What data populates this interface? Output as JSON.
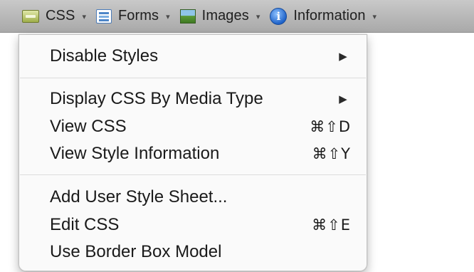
{
  "toolbar": {
    "items": [
      {
        "label": "CSS",
        "icon": "css-icon"
      },
      {
        "label": "Forms",
        "icon": "forms-icon"
      },
      {
        "label": "Images",
        "icon": "images-icon"
      },
      {
        "label": "Information",
        "icon": "info-icon",
        "icon_glyph": "i"
      }
    ],
    "caret": "▾"
  },
  "menu": {
    "items": [
      {
        "label": "Disable Styles",
        "arrow": "▶"
      },
      {
        "label": "Display CSS By Media Type",
        "arrow": "▶"
      },
      {
        "label": "View CSS",
        "shortcut": "⌘⇧D"
      },
      {
        "label": "View Style Information",
        "shortcut": "⌘⇧Y"
      },
      {
        "label": "Add User Style Sheet..."
      },
      {
        "label": "Edit CSS",
        "shortcut": "⌘⇧E"
      },
      {
        "label": "Use Border Box Model"
      }
    ]
  }
}
